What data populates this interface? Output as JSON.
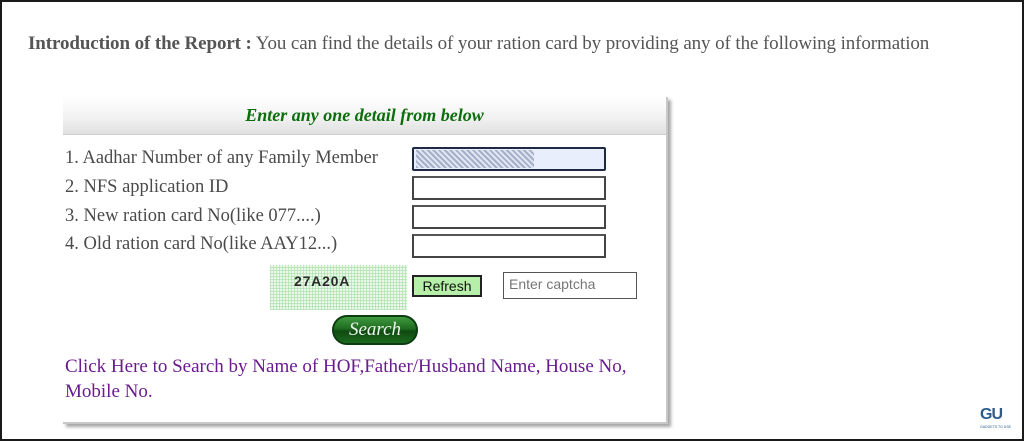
{
  "intro": {
    "label": "Introduction of the Report :",
    "text": " You can find the details of your ration card by providing any of the following information"
  },
  "panel": {
    "header": "Enter any one detail from below",
    "fields": [
      {
        "label": "1. Aadhar Number of any Family Member",
        "value": "",
        "filled": true
      },
      {
        "label": "2. NFS application ID",
        "value": ""
      },
      {
        "label": "3. New ration card No(like 077....)",
        "value": ""
      },
      {
        "label": "4. Old ration card No(like AAY12...)",
        "value": ""
      }
    ],
    "captcha_text": "27A20A",
    "refresh_label": "Refresh",
    "captcha_placeholder": "Enter captcha",
    "search_label": "Search",
    "hof_link": "Click Here to Search by Name of HOF,Father/Husband Name, House No, Mobile No."
  },
  "watermark": {
    "logo": "GU",
    "tiny_text": "GADGETS TO USE"
  }
}
